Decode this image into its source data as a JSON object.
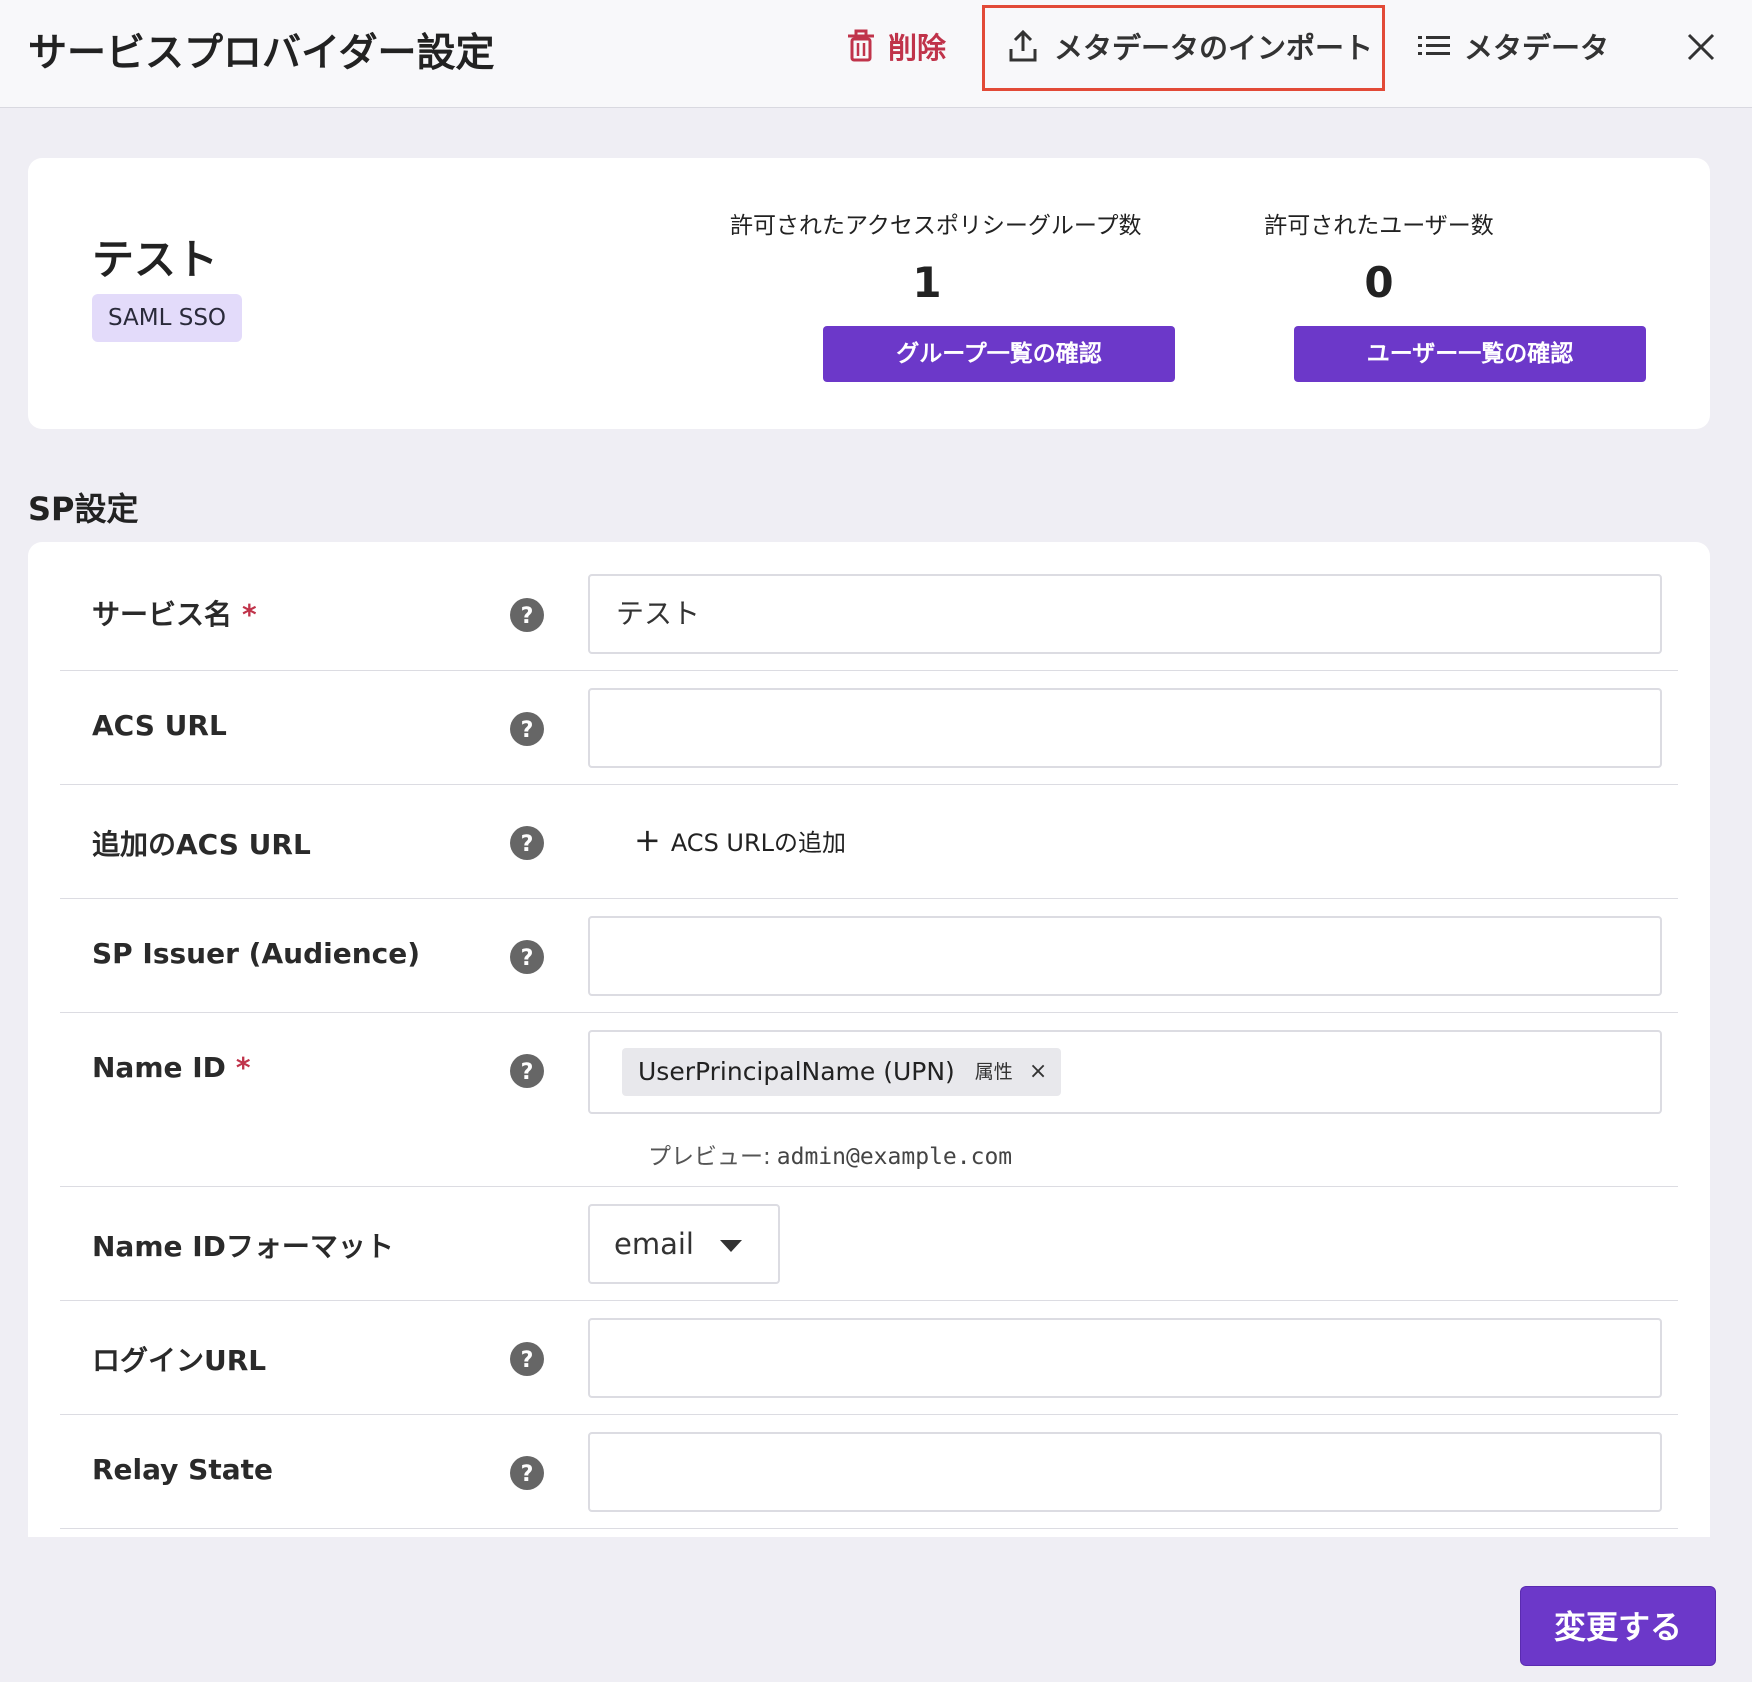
{
  "header": {
    "title": "サービスプロバイダー設定",
    "delete_label": "削除",
    "import_label": "メタデータのインポート",
    "metadata_label": "メタデータ"
  },
  "summary": {
    "name": "テスト",
    "badge": "SAML SSO",
    "groups_label": "許可されたアクセスポリシーグループ数",
    "groups_count": "1",
    "groups_button": "グループ一覧の確認",
    "users_label": "許可されたユーザー数",
    "users_count": "0",
    "users_button": "ユーザー一覧の確認"
  },
  "section_title": "SP設定",
  "form": {
    "service_name": {
      "label": "サービス名",
      "required": "*",
      "value": "テスト"
    },
    "acs_url": {
      "label": "ACS URL",
      "value": ""
    },
    "additional_acs": {
      "label": "追加のACS URL",
      "add_label": "ACS URLの追加"
    },
    "sp_issuer": {
      "label": "SP Issuer (Audience)",
      "value": ""
    },
    "name_id": {
      "label": "Name ID",
      "required": "*",
      "chip_name": "UserPrincipalName (UPN)",
      "chip_type": "属性",
      "preview_label": "プレビュー:",
      "preview_value": "admin@example.com"
    },
    "name_id_format": {
      "label": "Name IDフォーマット",
      "value": "email"
    },
    "login_url": {
      "label": "ログインURL",
      "value": ""
    },
    "relay_state": {
      "label": "Relay State",
      "value": ""
    }
  },
  "submit_label": "変更する",
  "colors": {
    "accent": "#6c38c9",
    "danger": "#c0334a",
    "highlight": "#e24a37",
    "badge_bg": "#e3dbfa"
  }
}
